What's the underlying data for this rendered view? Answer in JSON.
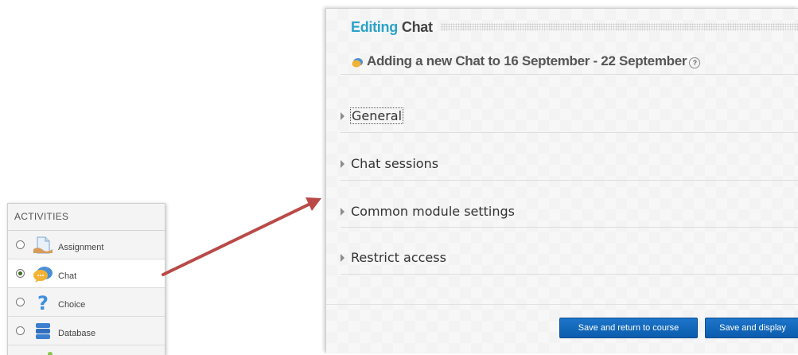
{
  "activities": {
    "header": "ACTIVITIES",
    "items": [
      {
        "label": "Assignment",
        "icon": "assignment-icon",
        "selected": false
      },
      {
        "label": "Chat",
        "icon": "chat-icon",
        "selected": true
      },
      {
        "label": "Choice",
        "icon": "choice-icon",
        "selected": false
      },
      {
        "label": "Database",
        "icon": "database-icon",
        "selected": false
      }
    ]
  },
  "editor": {
    "title_prefix": "Editing",
    "title_module": "Chat",
    "subtitle": "Adding a new Chat to 16 September - 22 September",
    "sections": [
      {
        "label": "General",
        "focused": true
      },
      {
        "label": "Chat sessions",
        "focused": false
      },
      {
        "label": "Common module settings",
        "focused": false
      },
      {
        "label": "Restrict access",
        "focused": false
      }
    ],
    "buttons": {
      "save_return": "Save and return to course",
      "save_display": "Save and display"
    }
  },
  "colors": {
    "title_accent": "#2aa3c9",
    "button_blue": "#0f66bb",
    "arrow_red": "#b94a48"
  }
}
